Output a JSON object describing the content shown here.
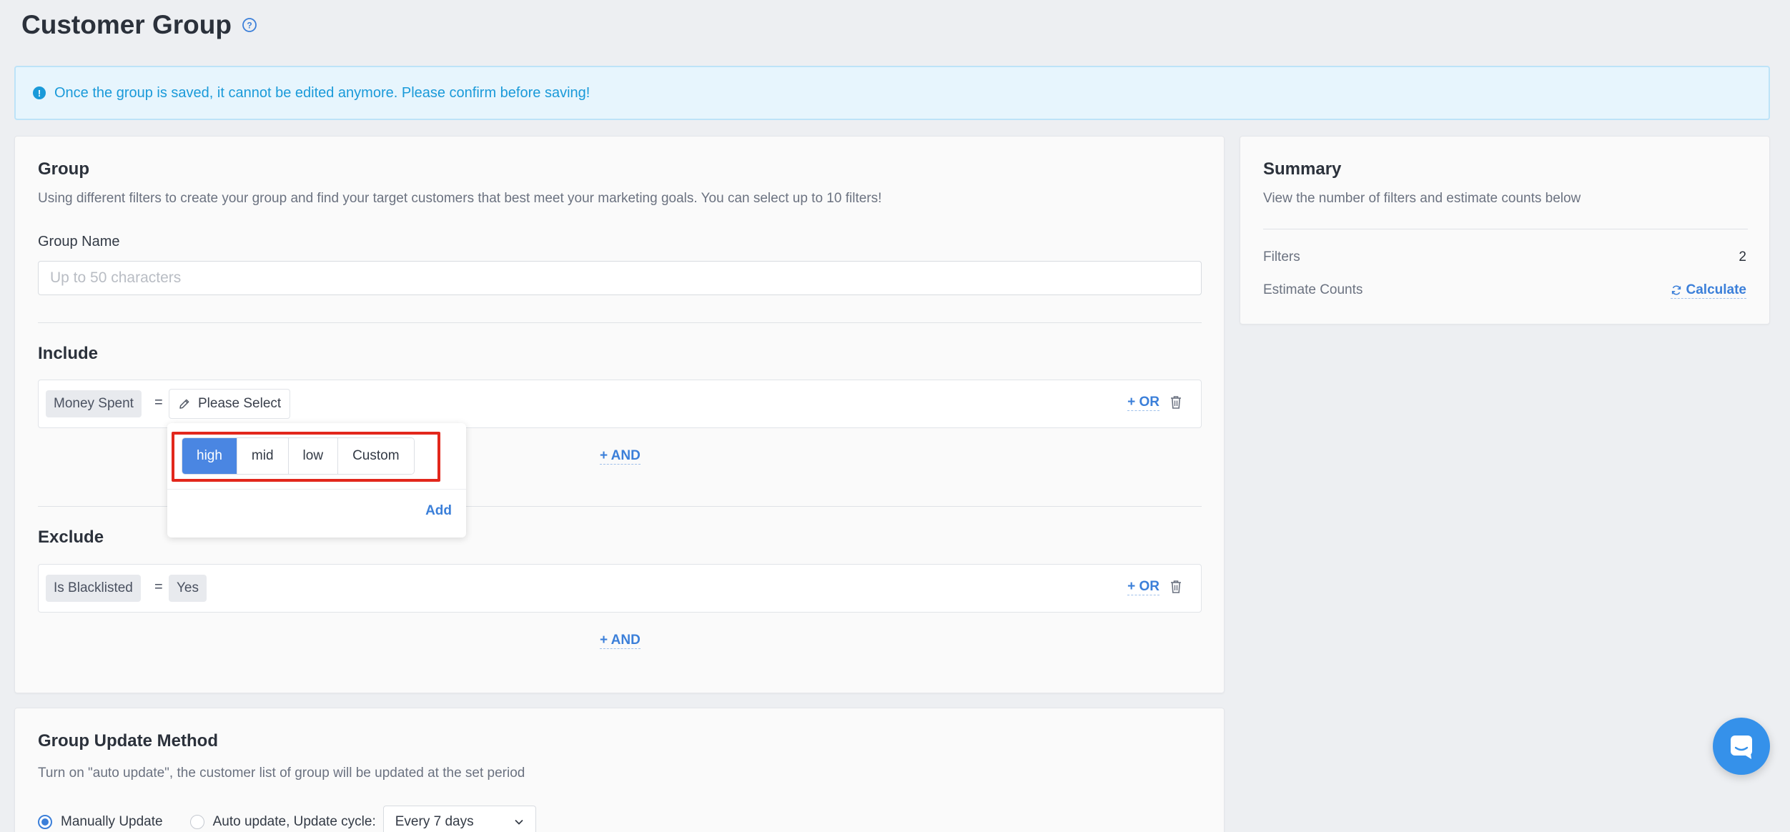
{
  "page": {
    "title": "Customer Group",
    "help_icon": "question-circle-icon"
  },
  "alert": {
    "icon": "info-icon",
    "text": "Once the group is saved, it cannot be edited anymore. Please confirm before saving!"
  },
  "group": {
    "title": "Group",
    "description": "Using different filters to create your group and find your target customers that best meet your marketing goals. You can select up to 10 filters!",
    "name_label": "Group Name",
    "name_value": "",
    "name_placeholder": "Up to 50 characters"
  },
  "include": {
    "title": "Include",
    "filter": {
      "field": "Money Spent",
      "operator": "=",
      "value_placeholder": "Please Select",
      "value_icon": "pencil-icon"
    },
    "or_label": "+ OR",
    "and_label": "+ AND"
  },
  "popover": {
    "options": [
      "high",
      "mid",
      "low",
      "Custom"
    ],
    "selected": "high",
    "add_label": "Add"
  },
  "exclude": {
    "title": "Exclude",
    "filter": {
      "field": "Is Blacklisted",
      "operator": "=",
      "value": "Yes"
    },
    "or_label": "+ OR",
    "and_label": "+ AND"
  },
  "summary": {
    "title": "Summary",
    "description": "View the number of filters and estimate counts below",
    "filters_label": "Filters",
    "filters_value": "2",
    "estimate_label": "Estimate Counts",
    "calculate_label": "Calculate",
    "calculate_icon": "refresh-icon"
  },
  "update_method": {
    "title": "Group Update Method",
    "description": "Turn on \"auto update\", the customer list of group will be updated at the set period",
    "manual_label": "Manually Update",
    "auto_label": "Auto update, Update cycle:",
    "selected": "manual",
    "cycle_value": "Every 7 days"
  },
  "colors": {
    "accent": "#3b7fd9",
    "active_segment": "#4a86e2",
    "highlight_border": "#e2271c",
    "alert_text": "#1a9ad9",
    "chat_button": "#3591ea"
  },
  "chat": {
    "icon": "chat-icon"
  }
}
